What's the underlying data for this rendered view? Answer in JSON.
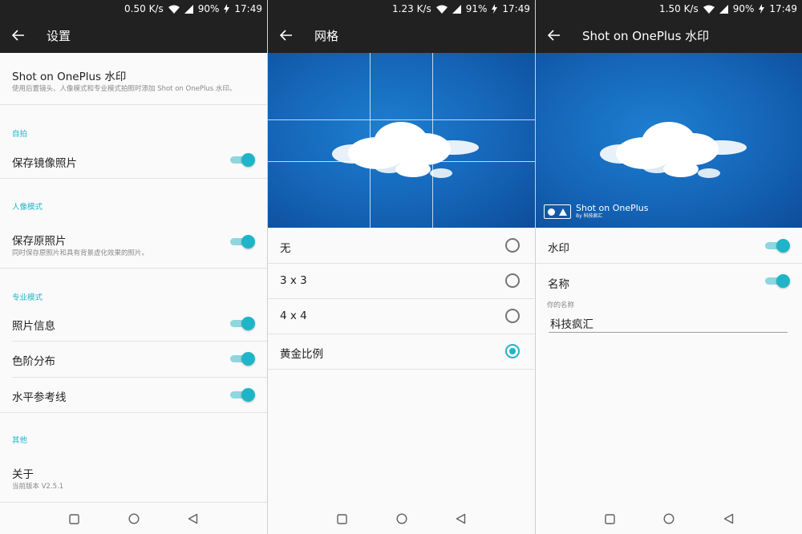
{
  "colors": {
    "accent": "#1fb5c8",
    "toolbar": "#212121",
    "background": "#fafafa"
  },
  "panel1": {
    "status": {
      "speed": "0.50 K/s",
      "battery": "90%",
      "time": "17:49"
    },
    "toolbar": {
      "back_icon": "arrow-left-icon",
      "title": "设置"
    },
    "watermark": {
      "title": "Shot on OnePlus 水印",
      "subtitle": "使用后置镜头、人像模式和专业模式拍照时添加 Shot on OnePlus 水印。"
    },
    "sections": {
      "selfie": "自拍",
      "portrait": "人像模式",
      "pro": "专业模式",
      "other": "其他"
    },
    "items": {
      "save_mirror": {
        "label": "保存镜像照片",
        "on": true
      },
      "save_original": {
        "label": "保存原照片",
        "desc": "同时保存原照片和具有背景虚化效果的照片。",
        "on": true
      },
      "photo_info": {
        "label": "照片信息",
        "on": true
      },
      "histogram": {
        "label": "色阶分布",
        "on": true
      },
      "horizon": {
        "label": "水平参考线",
        "on": true
      },
      "about": {
        "label": "关于",
        "desc": "当前版本 V2.5.1"
      }
    }
  },
  "panel2": {
    "status": {
      "speed": "1.23 K/s",
      "battery": "91%",
      "time": "17:49"
    },
    "toolbar": {
      "title": "网格"
    },
    "options": [
      {
        "label": "无",
        "selected": false
      },
      {
        "label": "3 x 3",
        "selected": false
      },
      {
        "label": "4 x 4",
        "selected": false
      },
      {
        "label": "黄金比例",
        "selected": true
      }
    ]
  },
  "panel3": {
    "status": {
      "speed": "1.50 K/s",
      "battery": "90%",
      "time": "17:49"
    },
    "toolbar": {
      "title": "Shot on OnePlus 水印"
    },
    "preview_watermark": {
      "line1": "Shot on OnePlus",
      "line2": "By 科技疯汇"
    },
    "items": {
      "watermark": {
        "label": "水印",
        "on": true
      },
      "name": {
        "label": "名称",
        "on": true
      }
    },
    "name_input": {
      "label": "你的名称",
      "value": "科技疯汇"
    }
  },
  "navbar": {
    "square_icon": "recents-square-icon",
    "circle_icon": "home-circle-icon",
    "triangle_icon": "back-triangle-icon"
  }
}
